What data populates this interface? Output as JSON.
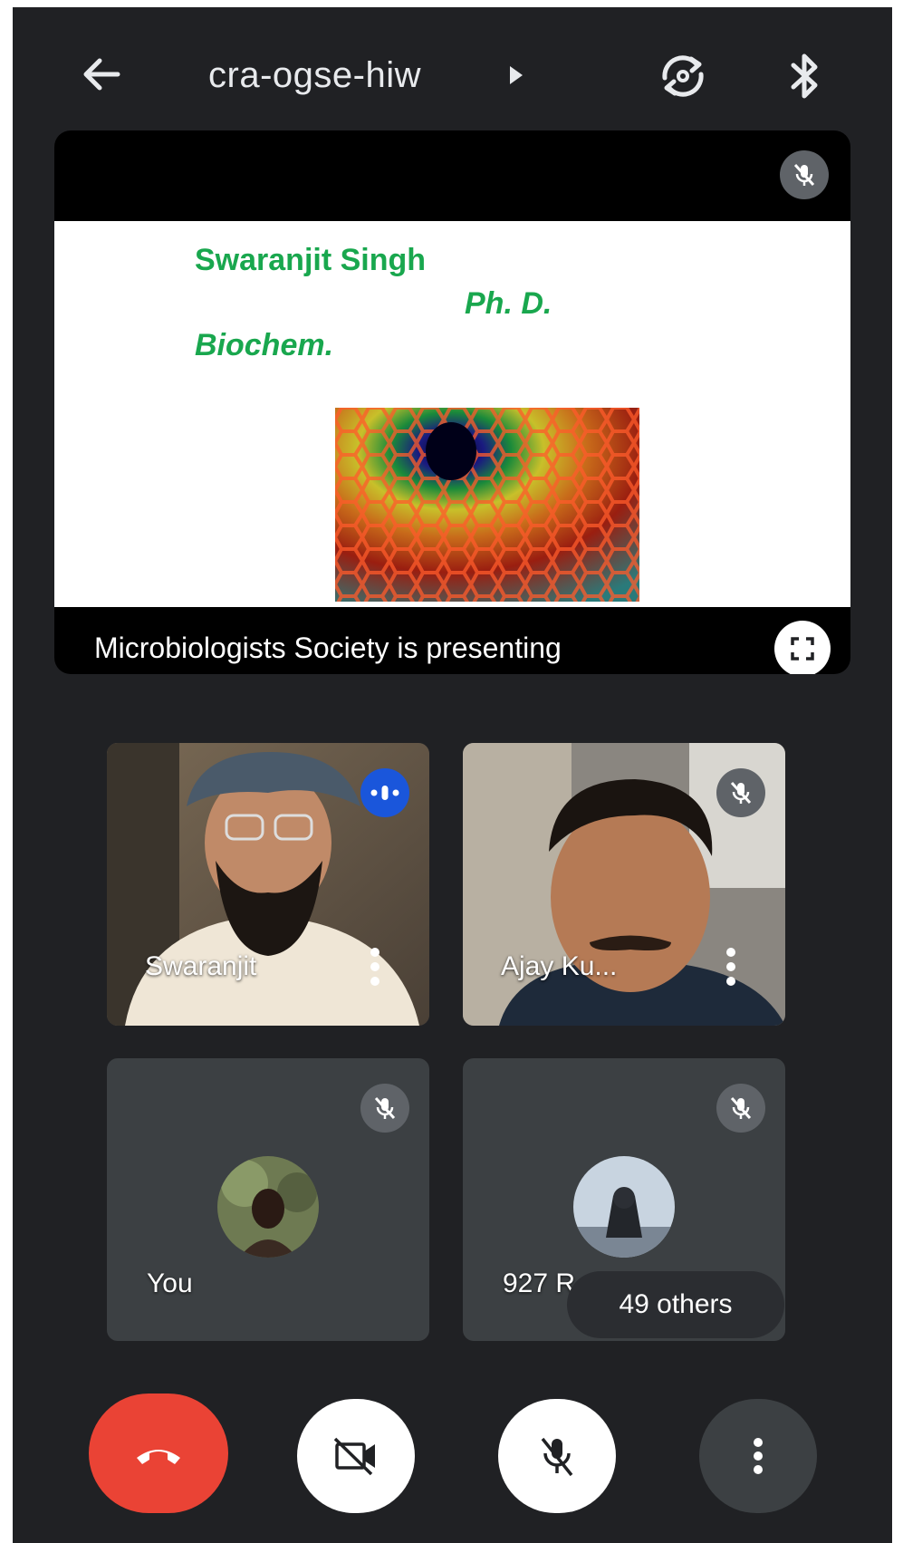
{
  "header": {
    "meeting_code": "cra-ogse-hiw",
    "icons": {
      "back": "arrow-left-icon",
      "caret": "caret-right-icon",
      "switch_camera": "camera-flip-icon",
      "audio_output": "bluetooth-icon"
    }
  },
  "presentation": {
    "slide": {
      "name": "Swaranjit Singh",
      "degree": "Ph. D.",
      "dept": "Biochem."
    },
    "status": "Microbiologists Society is presenting",
    "icons": {
      "mute": "mic-off-icon",
      "fullscreen": "fullscreen-icon"
    }
  },
  "participants": [
    {
      "name": "Swaranjit",
      "speaking": true
    },
    {
      "name": "Ajay Ku...",
      "muted": true
    },
    {
      "name": "You",
      "muted": true
    },
    {
      "name": "927 R",
      "muted": true
    }
  ],
  "others_label": "49 others",
  "controls": [
    {
      "icon": "end-call-icon",
      "color": "#ea4335"
    },
    {
      "icon": "camera-off-icon",
      "color": "#ffffff"
    },
    {
      "icon": "mic-off-icon",
      "color": "#ffffff"
    },
    {
      "icon": "more-vert-icon",
      "color": "#3c4043"
    }
  ],
  "colors": {
    "background": "#202124",
    "slide_text": "#19a74e",
    "speaking_badge": "#1a56db"
  }
}
